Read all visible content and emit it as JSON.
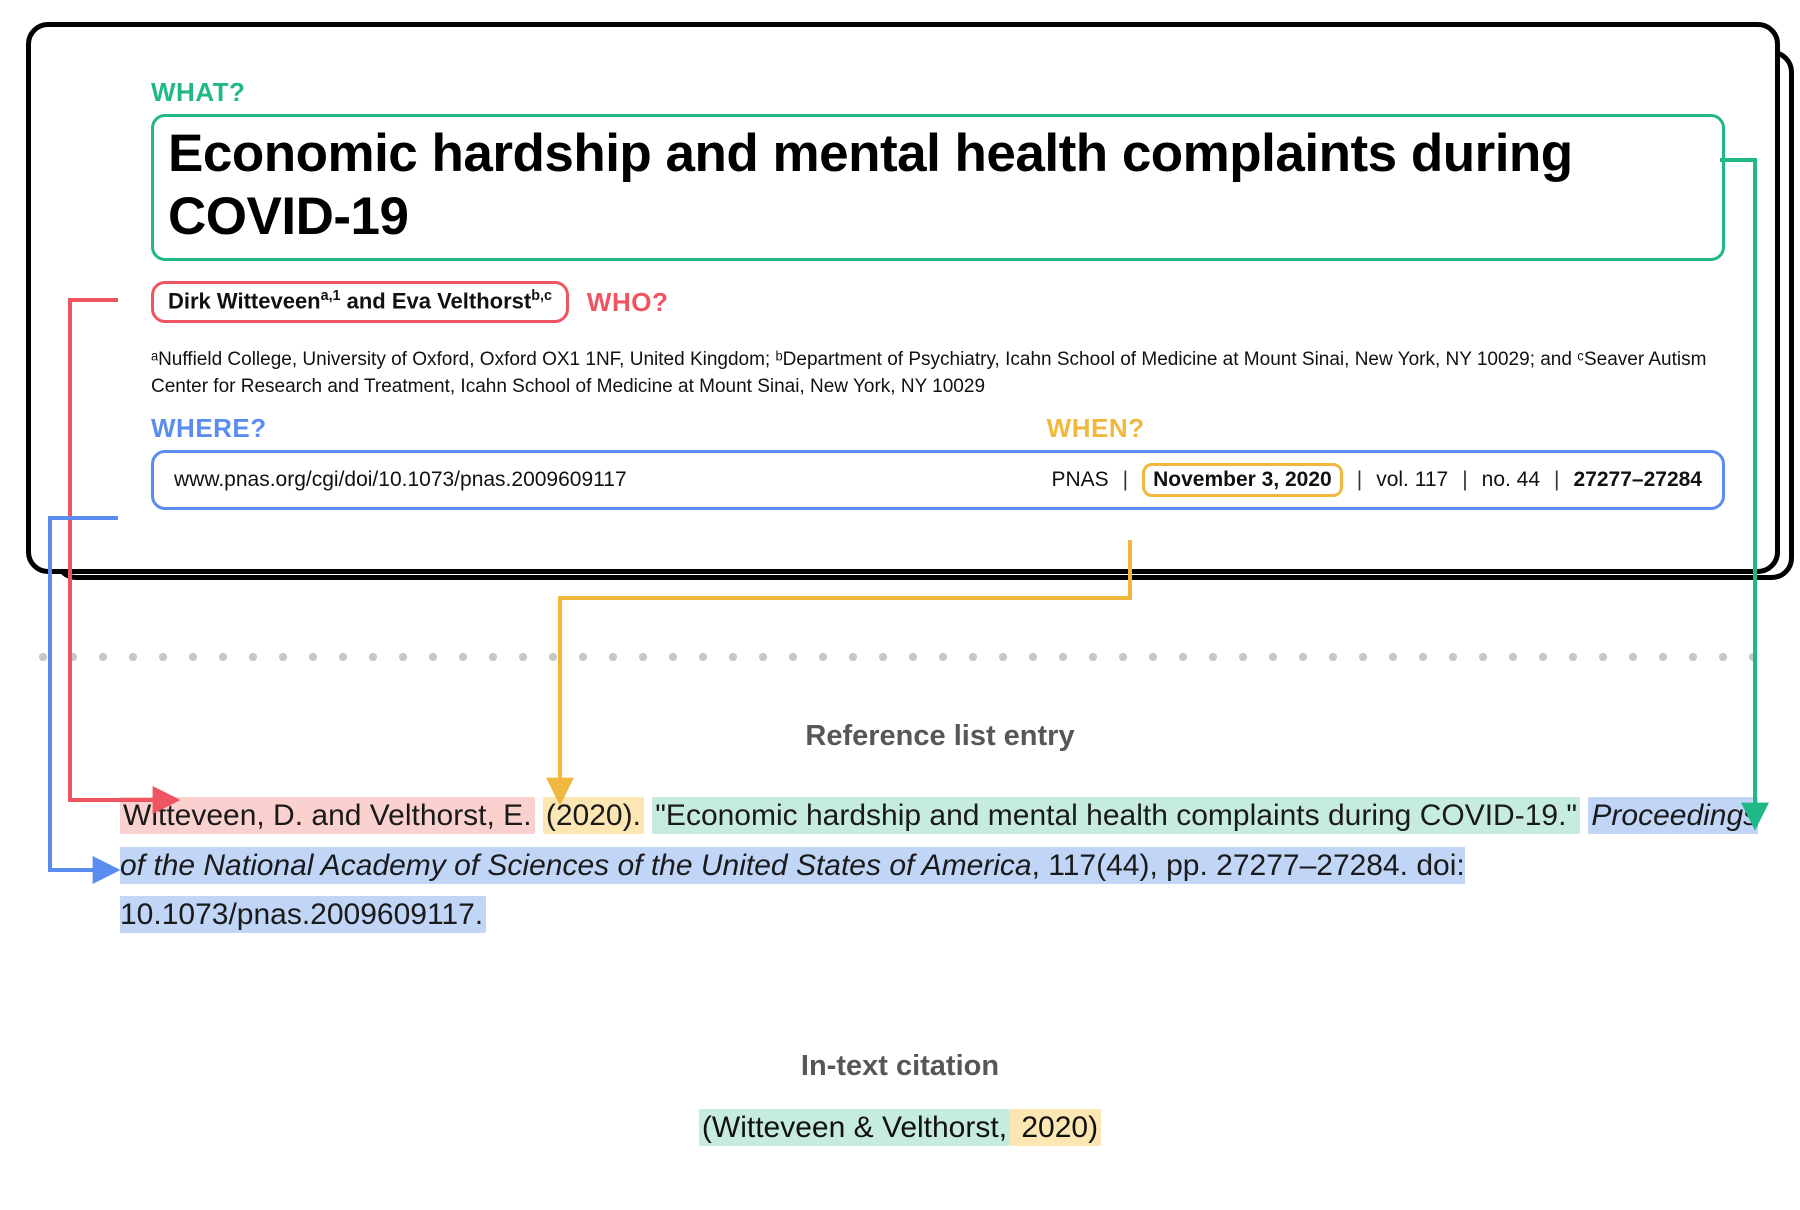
{
  "labels": {
    "what": "WHAT?",
    "who": "WHO?",
    "where": "WHERE?",
    "when": "WHEN?"
  },
  "paper": {
    "title": "Economic hardship and mental health complaints during COVID-19",
    "authors_html": "Dirk Witteveen",
    "authors_sup1": "a,1",
    "authors_join": " and Eva Velthorst",
    "authors_sup2": "b,c",
    "affiliations": "ᵃNuffield College, University of Oxford, Oxford OX1 1NF, United Kingdom; ᵇDepartment of Psychiatry, Icahn School of Medicine at Mount Sinai, New York, NY 10029; and ᶜSeaver Autism Center for Research and Treatment, Icahn School of Medicine at Mount Sinai, New York, NY 10029",
    "doi": "www.pnas.org/cgi/doi/10.1073/pnas.2009609117",
    "journal_abbrev": "PNAS",
    "date": "November 3, 2020",
    "vol": "vol. 117",
    "no": "no. 44",
    "pages": "27277–27284"
  },
  "reference": {
    "heading": "Reference list entry",
    "authors": "Witteveen, D. and Velthorst, E.",
    "year": "(2020).",
    "title": "\"Economic hardship and mental health complaints during COVID-19.\"",
    "journal": "Proceedings of the National Academy of Sciences of the United States of America",
    "loc": ", 117(44), pp. 27277–27284. doi: 10.1073/pnas.2009609117."
  },
  "intext": {
    "heading": "In-text citation",
    "open": "(",
    "authors": "Witteveen & Velthorst,",
    "year": " 2020",
    "close": ")"
  },
  "colors": {
    "green": "#20b884",
    "red": "#ef5560",
    "blue": "#5b8df0",
    "yellow": "#f0b83f"
  }
}
